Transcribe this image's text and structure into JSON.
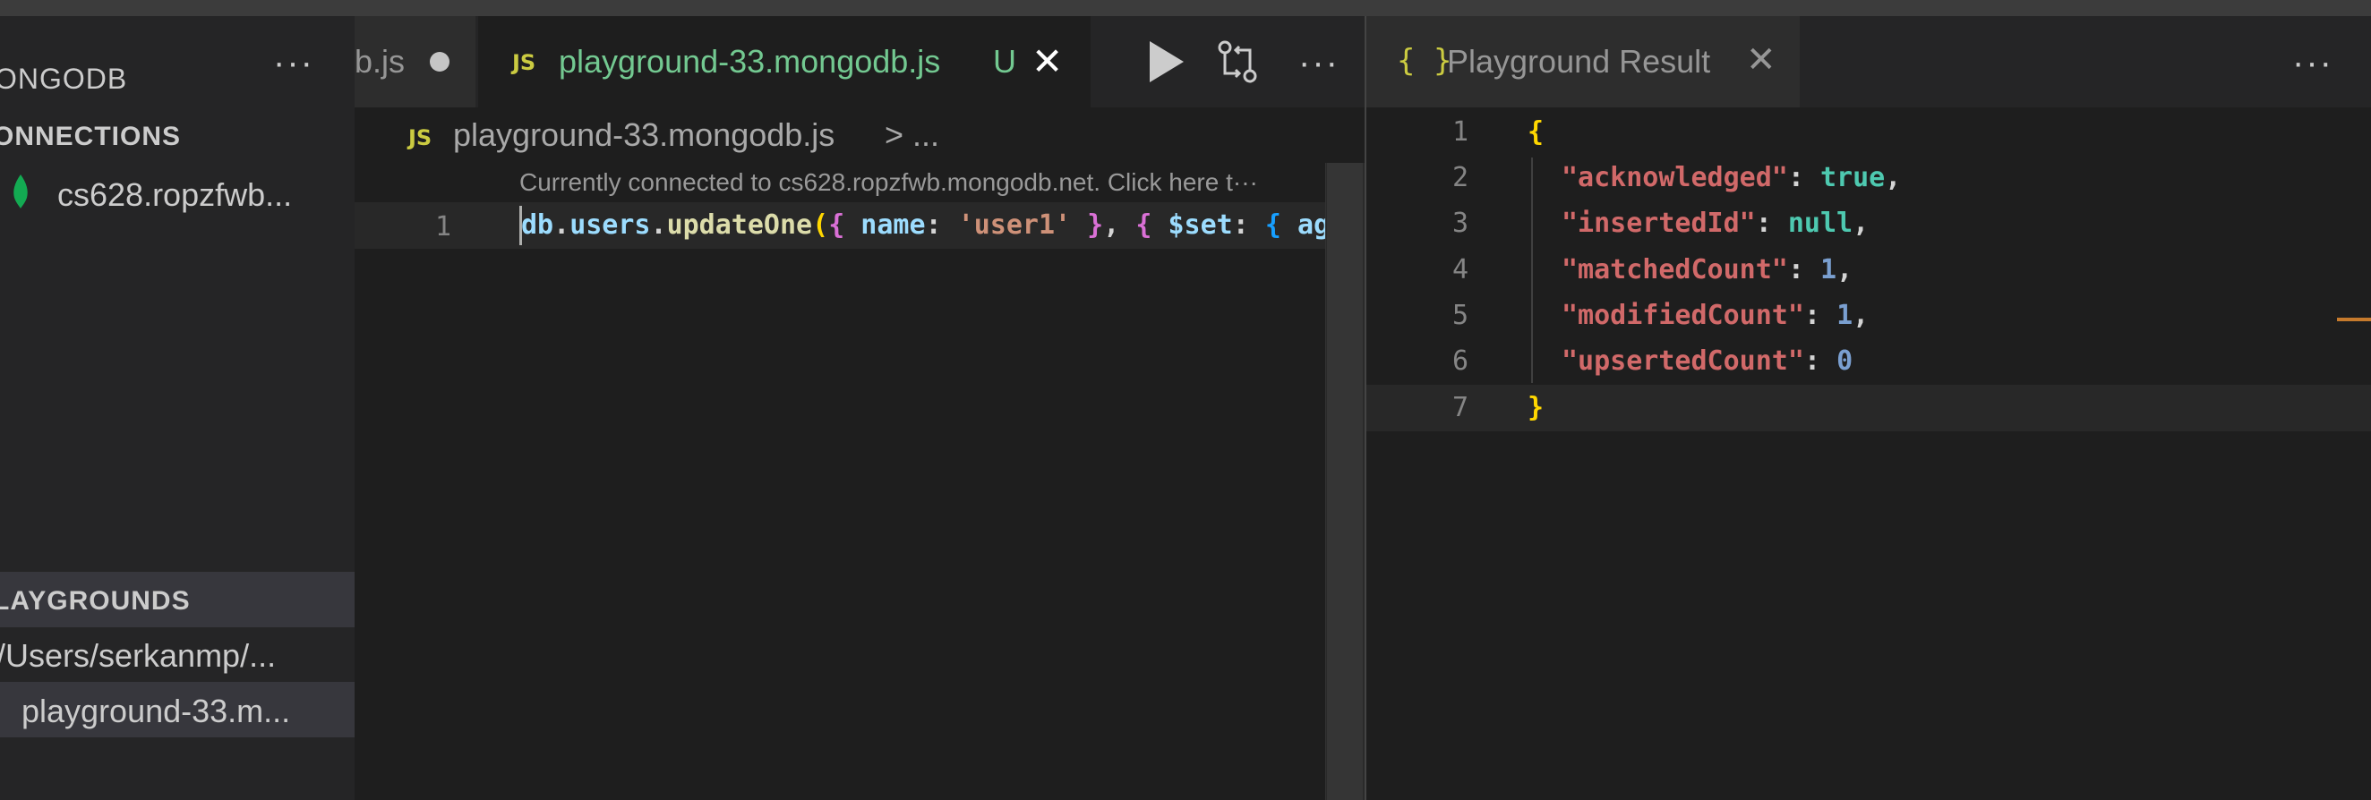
{
  "sidebar": {
    "title": "ONGODB",
    "more": "···",
    "connections_header": "ONNECTIONS",
    "connection_label": "cs628.ropzfwb...",
    "playgrounds_header": "LAYGROUNDS",
    "folder_label": "/Users/serkanmp/...",
    "file_label": "playground-33.m..."
  },
  "tabs": {
    "tab1_label": "b.js",
    "tab2_badge": "JS",
    "tab2_label": "playground-33.mongodb.js",
    "tab2_status": "U",
    "tab2_close": "✕",
    "more": "···"
  },
  "breadcrumb": {
    "badge": "JS",
    "file": "playground-33.mongodb.js",
    "rest": "> ..."
  },
  "editor": {
    "codelens": "Currently connected to cs628.ropzfwb.mongodb.net. Click here t···",
    "line_number": "1",
    "code": {
      "db": "db",
      "dot1": ".",
      "users": "users",
      "dot2": ".",
      "fn": "updateOne",
      "paren": "(",
      "brace1": "{",
      "key1": " name",
      "colon1": ": ",
      "str1": "'user1'",
      "brace1c": " }",
      "comma": ", ",
      "brace2": "{",
      "key2": " $set",
      "colon2": ": ",
      "brace3": "{",
      "tail": " ag"
    }
  },
  "result": {
    "tab_icon": "{ }",
    "tab_label": "Playground Result",
    "tab_close": "✕",
    "more": "···",
    "lines": [
      "1",
      "2",
      "3",
      "4",
      "5",
      "6",
      "7"
    ],
    "open_brace": "{",
    "close_brace": "}",
    "k_ack": "\"acknowledged\"",
    "v_ack": "true",
    "k_ins": "\"insertedId\"",
    "v_ins": "null",
    "k_match": "\"matchedCount\"",
    "v_match": "1",
    "k_mod": "\"modifiedCount\"",
    "v_mod": "1",
    "k_ups": "\"upsertedCount\"",
    "v_ups": "0",
    "colon": ": ",
    "comma": ","
  }
}
